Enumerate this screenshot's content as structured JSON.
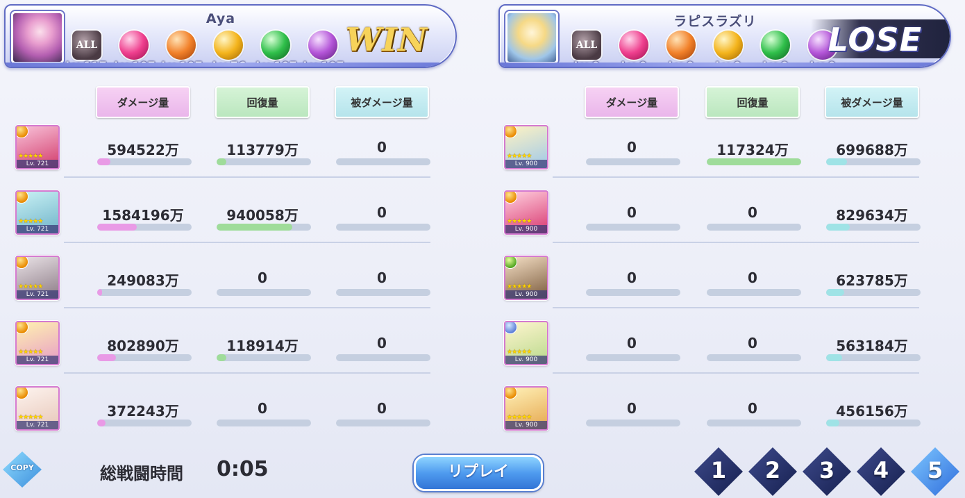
{
  "players": [
    {
      "name": "Aya",
      "result": "WIN",
      "levels": [
        "Lv 117",
        "Lv 107",
        "Lv 107",
        "Lv 76",
        "Lv 107",
        "Lv 107"
      ],
      "icon_names": [
        "all-element-icon",
        "fire-element-icon",
        "shield-element-icon",
        "gold-element-icon",
        "wind-element-icon",
        "book-element-icon"
      ],
      "headers": [
        "ダメージ量",
        "回復量",
        "被ダメージ量"
      ],
      "units": [
        {
          "level": "Lv. 721",
          "damage": "594522万",
          "heal": "113779万",
          "taken": "0",
          "damage_frac": 0.14,
          "heal_frac": 0.1,
          "taken_frac": 0.0
        },
        {
          "level": "Lv. 721",
          "damage": "1584196万",
          "heal": "940058万",
          "taken": "0",
          "damage_frac": 0.42,
          "heal_frac": 0.8,
          "taken_frac": 0.0
        },
        {
          "level": "Lv. 721",
          "damage": "249083万",
          "heal": "0",
          "taken": "0",
          "damage_frac": 0.05,
          "heal_frac": 0.0,
          "taken_frac": 0.0
        },
        {
          "level": "Lv. 721",
          "damage": "802890万",
          "heal": "118914万",
          "taken": "0",
          "damage_frac": 0.2,
          "heal_frac": 0.1,
          "taken_frac": 0.0
        },
        {
          "level": "Lv. 721",
          "damage": "372243万",
          "heal": "0",
          "taken": "0",
          "damage_frac": 0.09,
          "heal_frac": 0.0,
          "taken_frac": 0.0
        }
      ]
    },
    {
      "name": "ラピスラズリ",
      "result": "LOSE",
      "levels": [
        "Lv 0",
        "Lv 0",
        "Lv 0",
        "Lv 0",
        "Lv 0",
        "Lv 0"
      ],
      "icon_names": [
        "all-element-icon",
        "fire-element-icon",
        "shield-element-icon",
        "gold-element-icon",
        "wind-element-icon",
        "book-element-icon"
      ],
      "headers": [
        "ダメージ量",
        "回復量",
        "被ダメージ量"
      ],
      "units": [
        {
          "level": "Lv. 900",
          "damage": "0",
          "heal": "117324万",
          "taken": "699688万",
          "damage_frac": 0.0,
          "heal_frac": 1.0,
          "taken_frac": 0.22
        },
        {
          "level": "Lv. 900",
          "damage": "0",
          "heal": "0",
          "taken": "829634万",
          "damage_frac": 0.0,
          "heal_frac": 0.0,
          "taken_frac": 0.25
        },
        {
          "level": "Lv. 900",
          "damage": "0",
          "heal": "0",
          "taken": "623785万",
          "damage_frac": 0.0,
          "heal_frac": 0.0,
          "taken_frac": 0.19
        },
        {
          "level": "Lv. 900",
          "damage": "0",
          "heal": "0",
          "taken": "563184万",
          "damage_frac": 0.0,
          "heal_frac": 0.0,
          "taken_frac": 0.17
        },
        {
          "level": "Lv. 900",
          "damage": "0",
          "heal": "0",
          "taken": "456156万",
          "damage_frac": 0.0,
          "heal_frac": 0.0,
          "taken_frac": 0.14
        }
      ]
    }
  ],
  "footer": {
    "copy_label": "COPY",
    "time_label": "総戦闘時間",
    "time_value": "0:05",
    "replay_label": "リプレイ",
    "pages": [
      "1",
      "2",
      "3",
      "4",
      "5"
    ],
    "active_page": "5"
  },
  "colors": {
    "damage_bar": "#e99ae6",
    "heal_bar": "#9fdc9a",
    "taken_bar": "#9fe3e6",
    "bar_track": "#c5cfe0",
    "win_text": "#f7d35a",
    "page_button": "#16204f",
    "page_button_active": "#2f6ddc"
  }
}
